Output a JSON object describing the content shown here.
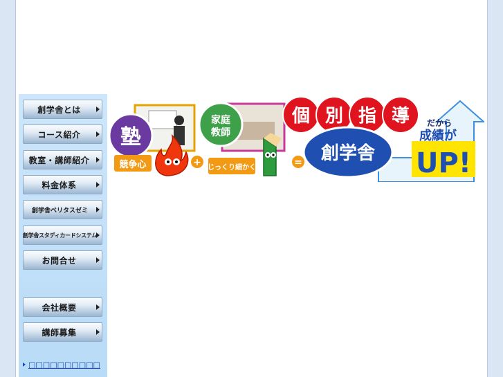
{
  "nav": {
    "items": [
      {
        "label": "創学舎とは"
      },
      {
        "label": "コース紹介"
      },
      {
        "label": "教室・講師紹介"
      },
      {
        "label": "料金体系"
      },
      {
        "label": "創学舎ベリタスゼミ"
      },
      {
        "label": "創学舎スタディカードシステム"
      },
      {
        "label": "お問合せ"
      },
      {
        "label": "会社概要"
      },
      {
        "label": "講師募集"
      }
    ],
    "mobile_link": "□□□□□□□□□□"
  },
  "banner": {
    "juku": "塾",
    "kyousoushin": "競争心",
    "katei_kyoushi_1": "家庭",
    "katei_kyoushi_2": "教師",
    "jikkuri": "じっくり細かく",
    "plus": "+",
    "equals": "=",
    "kobetsu": [
      "個",
      "別",
      "指",
      "導"
    ],
    "sougakusha": "創学舎",
    "dakara": "だから",
    "seiseki": "成績が",
    "up": "UP!"
  },
  "colors": {
    "sidebar_bg": "#c4e1f9",
    "page_bg": "#dbe6f4",
    "red": "#e0141e",
    "blue": "#1f4fb0",
    "purple": "#6a3a9a",
    "green": "#2c9a3a",
    "orange": "#f39a14",
    "yellow": "#ffe400"
  }
}
